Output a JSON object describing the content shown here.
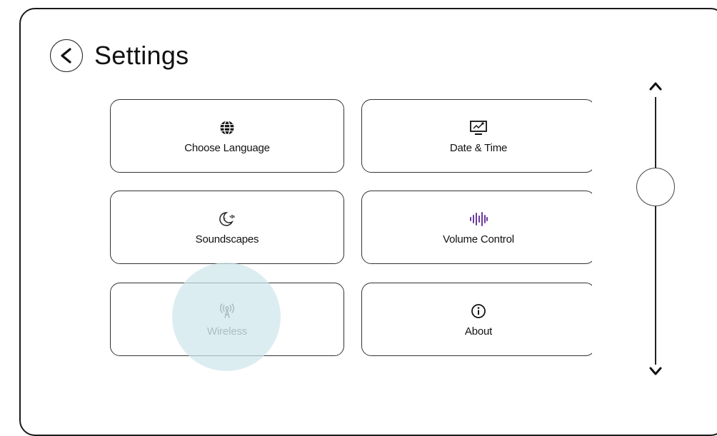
{
  "header": {
    "title": "Settings",
    "back_icon": "chevron-left-icon"
  },
  "tiles": [
    {
      "label": "Choose Language",
      "icon": "globe-icon"
    },
    {
      "label": "Date & Time",
      "icon": "monitor-chart-icon"
    },
    {
      "label": "Soundscapes",
      "icon": "moon-sound-icon"
    },
    {
      "label": "Volume Control",
      "icon": "sound-wave-icon"
    },
    {
      "label": "Wireless",
      "icon": "antenna-icon"
    },
    {
      "label": "About",
      "icon": "info-icon"
    }
  ],
  "scrollbar": {
    "up_icon": "chevron-up-icon",
    "down_icon": "chevron-down-icon"
  },
  "colors": {
    "volume_icon": "#6a3aa0",
    "highlight": "#cee6ec"
  }
}
